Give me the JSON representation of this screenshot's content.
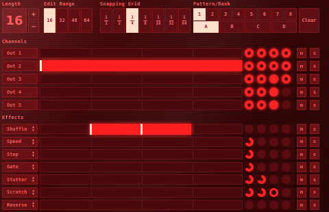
{
  "headers": {
    "length": "Length",
    "edit_range": "Edit Range",
    "snapping_grid": "Snapping Grid",
    "pattern_bank": "Pattern/Bank",
    "channels": "Channels",
    "effects": "Effects"
  },
  "length": {
    "value": "16",
    "plus": "+",
    "minus": "−"
  },
  "edit_range": {
    "options": [
      "16",
      "32",
      "48",
      "64"
    ],
    "selected": "16"
  },
  "snapping_grid": {
    "options": [
      [
        "1",
        "1"
      ],
      [
        "1",
        "2"
      ],
      [
        "1",
        "4"
      ],
      [
        "1",
        "8"
      ],
      [
        "1",
        "16"
      ],
      [
        "1",
        "32"
      ],
      [
        "1",
        "64"
      ]
    ],
    "selected_index": 2
  },
  "pattern": {
    "numbers": [
      "1",
      "2",
      "3",
      "4",
      "5",
      "6",
      "7",
      "8"
    ],
    "selected": "1"
  },
  "bank": {
    "letters": [
      "A",
      "B",
      "C",
      "D"
    ],
    "selected": "A"
  },
  "clear_label": "Clear",
  "mute_label": "m",
  "solo_label": "s",
  "channels": [
    {
      "name": "Out 1",
      "knobs": [
        "full",
        "full",
        "full",
        "full"
      ]
    },
    {
      "name": "Out 2",
      "knobs": [
        "full",
        "full",
        "full",
        "full"
      ]
    },
    {
      "name": "Out 3",
      "knobs": [
        "full",
        "full",
        "solid",
        "full"
      ]
    },
    {
      "name": "Out 4",
      "knobs": [
        "full",
        "full",
        "solid",
        "dim"
      ]
    },
    {
      "name": "Out 5",
      "knobs": [
        "full",
        "full",
        "solid",
        "dim"
      ]
    }
  ],
  "effects": [
    {
      "name": "Shuffle",
      "knobs": [
        "dim",
        "dim",
        "dim",
        "dim"
      ]
    },
    {
      "name": "Speed",
      "knobs": [
        "pac",
        "dim",
        "dim",
        "dim"
      ]
    },
    {
      "name": "Step",
      "knobs": [
        "pac",
        "dim",
        "dim",
        "dim"
      ]
    },
    {
      "name": "Gate",
      "knobs": [
        "pac",
        "dim",
        "dim",
        "dim"
      ]
    },
    {
      "name": "Stutter",
      "knobs": [
        "pac",
        "pac",
        "dim",
        "dim"
      ]
    },
    {
      "name": "Scratch",
      "knobs": [
        "pac",
        "pac",
        "ring",
        "dim"
      ]
    },
    {
      "name": "Reverse",
      "knobs": [
        "dim",
        "dim",
        "dim",
        "dim"
      ]
    }
  ],
  "colors": {
    "accent": "#ff2424",
    "highlight": "#ffe0cf",
    "background": "#2a0607"
  }
}
